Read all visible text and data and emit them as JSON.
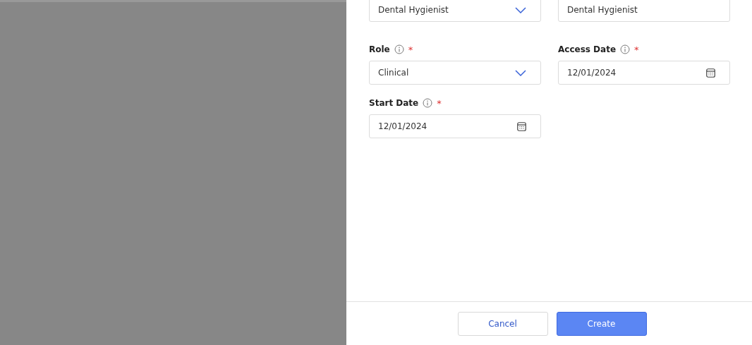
{
  "form": {
    "fields": [
      {
        "kind": "select",
        "value": "Dental Hygienist"
      },
      {
        "kind": "text",
        "value": "Dental Hygienist"
      },
      {
        "kind": "select",
        "label": "Role",
        "required_mark": "*",
        "value": "Clinical"
      },
      {
        "kind": "date",
        "label": "Access Date",
        "required_mark": "*",
        "value": "12/01/2024"
      },
      {
        "kind": "date",
        "label": "Start Date",
        "required_mark": "*",
        "value": "12/01/2024"
      }
    ]
  },
  "footer": {
    "cancel": "Cancel",
    "create": "Create"
  }
}
